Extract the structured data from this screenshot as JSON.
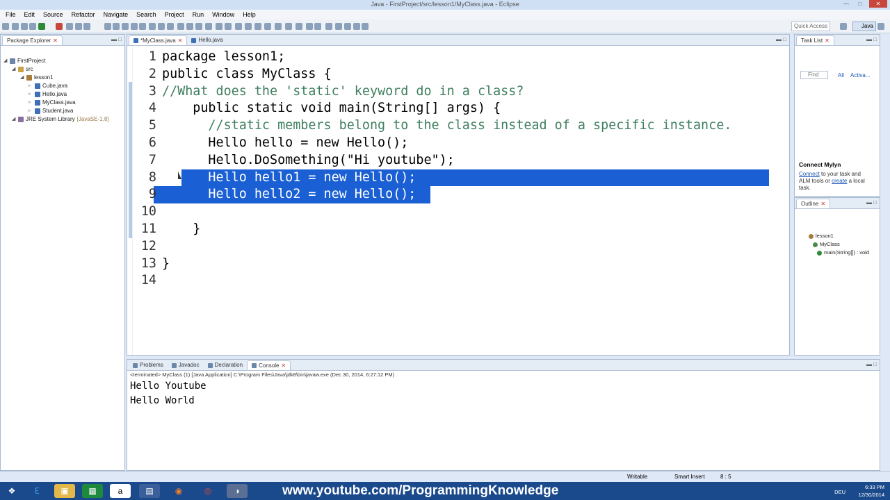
{
  "window": {
    "title": "Java - FirstProject/src/lesson1/MyClass.java - Eclipse"
  },
  "menu": [
    "File",
    "Edit",
    "Source",
    "Refactor",
    "Navigate",
    "Search",
    "Project",
    "Run",
    "Window",
    "Help"
  ],
  "toolbar": {
    "quick_access": "Quick Access",
    "perspective": "Java"
  },
  "package_explorer": {
    "tab": "Package Explorer",
    "tree": [
      {
        "label": "FirstProject",
        "indent": 0,
        "kind": "project"
      },
      {
        "label": "src",
        "indent": 1,
        "kind": "folder"
      },
      {
        "label": "lesson1",
        "indent": 2,
        "kind": "package"
      },
      {
        "label": "Cube.java",
        "indent": 3,
        "kind": "java"
      },
      {
        "label": "Hello.java",
        "indent": 3,
        "kind": "java"
      },
      {
        "label": "MyClass.java",
        "indent": 3,
        "kind": "java"
      },
      {
        "label": "Student.java",
        "indent": 3,
        "kind": "java"
      },
      {
        "label": "JRE System Library",
        "suffix": "[JavaSE-1.8]",
        "indent": 1,
        "kind": "lib"
      }
    ]
  },
  "editor": {
    "tabs": [
      {
        "label": "*MyClass.java",
        "active": true
      },
      {
        "label": "Hello.java",
        "active": false
      }
    ],
    "lines": [
      {
        "n": "1",
        "text": "package lesson1;",
        "cls": ""
      },
      {
        "n": "2",
        "text": "public class MyClass {",
        "cls": ""
      },
      {
        "n": "3",
        "text": "//What does the 'static' keyword do in a class?",
        "cls": "cm"
      },
      {
        "n": "4",
        "text": "    public static void main(String[] args) {",
        "cls": ""
      },
      {
        "n": "5",
        "text": "      //static members belong to the class instead of a specific instance.",
        "cls": "cm"
      },
      {
        "n": "6",
        "text": "      Hello hello = new Hello();",
        "cls": ""
      },
      {
        "n": "7",
        "text": "      Hello.DoSomething(\"Hi youtube\");",
        "cls": ""
      },
      {
        "n": "8",
        "text": "      Hello hello1 = new Hello();",
        "cls": "sel"
      },
      {
        "n": "9",
        "text": "      Hello hello2 = new Hello();",
        "cls": "sel"
      },
      {
        "n": "10",
        "text": "",
        "cls": ""
      },
      {
        "n": "11",
        "text": "    }",
        "cls": ""
      },
      {
        "n": "12",
        "text": "",
        "cls": ""
      },
      {
        "n": "13",
        "text": "}",
        "cls": ""
      },
      {
        "n": "14",
        "text": "",
        "cls": ""
      }
    ]
  },
  "task_list": {
    "tab": "Task List",
    "find_placeholder": "Find",
    "all": "All",
    "activate": "Activa..."
  },
  "mylyn": {
    "title": "Connect Mylyn",
    "connect": "Connect",
    "text1": " to your task and",
    "text2": "ALM tools or ",
    "create": "create",
    "text3": " a local",
    "text4": "task."
  },
  "outline": {
    "tab": "Outline",
    "items": [
      "lesson1",
      "MyClass",
      "main(String[]) : void"
    ]
  },
  "bottom": {
    "tabs": [
      {
        "label": "Problems"
      },
      {
        "label": "Javadoc"
      },
      {
        "label": "Declaration"
      },
      {
        "label": "Console",
        "active": true
      }
    ],
    "terminated": "<terminated> MyClass (1) [Java Application] C:\\Program Files\\Java\\jdk8\\bin\\javaw.exe (Dec 30, 2014, 6:27:12 PM)",
    "output": [
      "Hello Youtube",
      "Hello World"
    ]
  },
  "status": {
    "writable": "Writable",
    "insert": "Smart Insert",
    "position": "8 : 5"
  },
  "taskbar": {
    "url": "www.youtube.com/ProgrammingKnowledge",
    "time": "6:33 PM",
    "date": "12/30/2014",
    "lang": "DEU"
  }
}
